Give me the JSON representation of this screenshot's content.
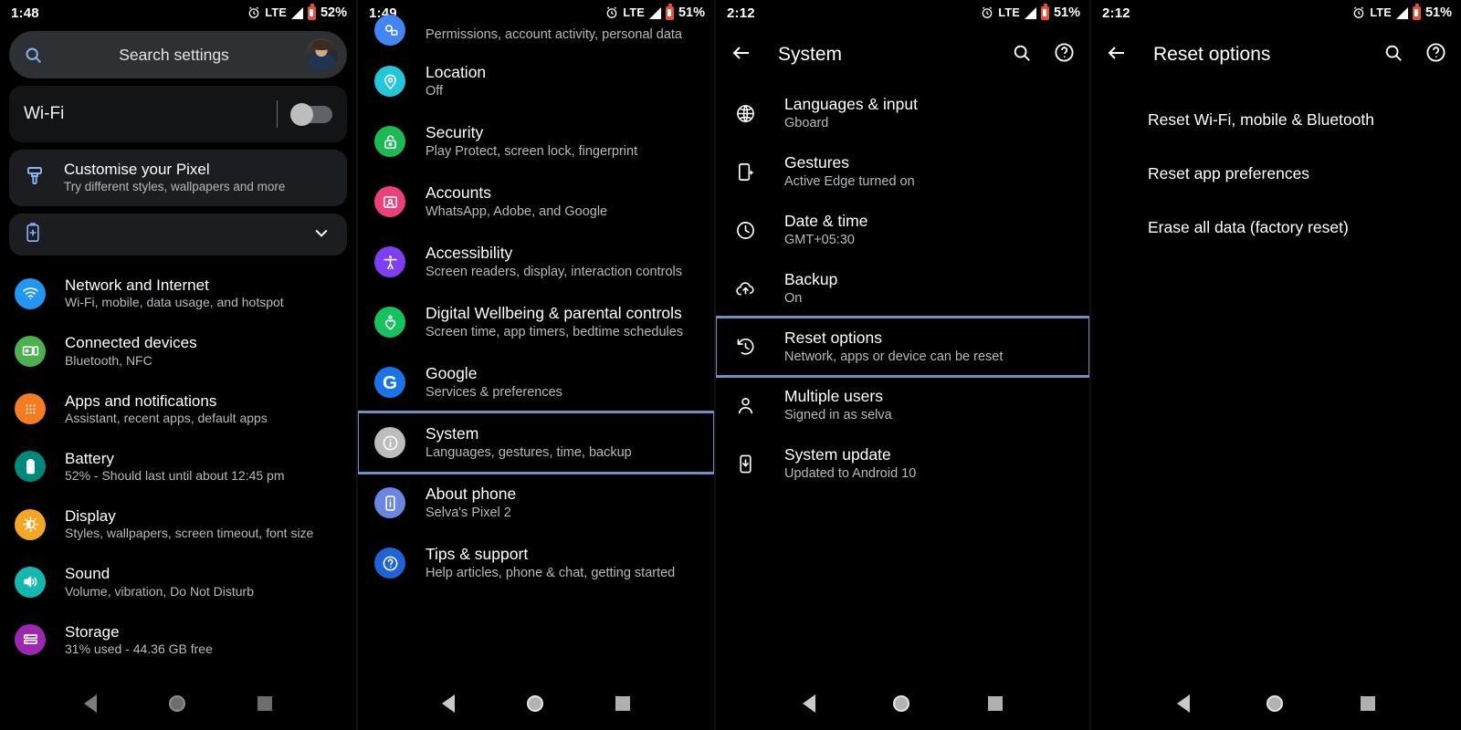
{
  "panels": [
    {
      "id": "settings-home",
      "status": {
        "time": "1:48",
        "network": "LTE",
        "battery_pct": "52%"
      },
      "search": {
        "placeholder": "Search settings"
      },
      "wifi_card": {
        "label": "Wi-Fi",
        "toggle_state": "off"
      },
      "customise_card": {
        "title": "Customise your Pixel",
        "subtitle": "Try different styles, wallpapers and more"
      },
      "battery_card": {
        "icon": "battery-plus-icon",
        "chevron": "chevron-down-icon"
      },
      "items": [
        {
          "title": "Network and Internet",
          "subtitle": "Wi-Fi, mobile, data usage, and hotspot",
          "icon": "wifi-icon",
          "color": "#2196f3"
        },
        {
          "title": "Connected devices",
          "subtitle": "Bluetooth, NFC",
          "icon": "devices-icon",
          "color": "#4caf50"
        },
        {
          "title": "Apps and notifications",
          "subtitle": "Assistant, recent apps, default apps",
          "icon": "apps-grid-icon",
          "color": "#f57c20"
        },
        {
          "title": "Battery",
          "subtitle": "52% - Should last until about 12:45 pm",
          "icon": "battery-icon",
          "color": "#00897b"
        },
        {
          "title": "Display",
          "subtitle": "Styles, wallpapers, screen timeout, font size",
          "icon": "brightness-icon",
          "color": "#f5a623"
        },
        {
          "title": "Sound",
          "subtitle": "Volume, vibration, Do Not Disturb",
          "icon": "volume-icon",
          "color": "#14b8b0"
        },
        {
          "title": "Storage",
          "subtitle": "31% used - 44.36 GB free",
          "icon": "storage-icon",
          "color": "#9c27b0"
        }
      ]
    },
    {
      "id": "settings-scrolled",
      "status": {
        "time": "1:49",
        "network": "LTE",
        "battery_pct": "51%"
      },
      "partial_top": {
        "subtitle": "Permissions, account activity, personal data",
        "icon": "privacy-icon",
        "color": "#4285f4"
      },
      "items": [
        {
          "title": "Location",
          "subtitle": "Off",
          "icon": "location-pin-icon",
          "color": "#26c6da"
        },
        {
          "title": "Security",
          "subtitle": "Play Protect, screen lock, fingerprint",
          "icon": "unlock-icon",
          "color": "#1db954"
        },
        {
          "title": "Accounts",
          "subtitle": "WhatsApp, Adobe, and Google",
          "icon": "account-card-icon",
          "color": "#ec407a"
        },
        {
          "title": "Accessibility",
          "subtitle": "Screen readers, display, interaction controls",
          "icon": "accessibility-icon",
          "color": "#7e3ff2"
        },
        {
          "title": "Digital Wellbeing & parental controls",
          "subtitle": "Screen time, app timers, bedtime schedules",
          "icon": "wellbeing-heart-icon",
          "color": "#16c25e"
        },
        {
          "title": "Google",
          "subtitle": "Services & preferences",
          "icon": "google-g-icon",
          "color": "#1a73e8"
        },
        {
          "title": "System",
          "subtitle": "Languages, gestures, time, backup",
          "icon": "info-icon",
          "color": "#bdbdbd",
          "highlighted": true
        },
        {
          "title": "About phone",
          "subtitle": "Selva's Pixel 2",
          "icon": "phone-info-icon",
          "color": "#6b86e0"
        },
        {
          "title": "Tips & support",
          "subtitle": "Help articles, phone & chat, getting started",
          "icon": "help-icon",
          "color": "#1f63d6"
        }
      ]
    },
    {
      "id": "system",
      "status": {
        "time": "2:12",
        "network": "LTE",
        "battery_pct": "51%"
      },
      "appbar": {
        "title": "System",
        "back": "back-arrow-icon",
        "search": "search-icon",
        "help": "help-icon"
      },
      "items": [
        {
          "title": "Languages & input",
          "subtitle": "Gboard",
          "icon": "globe-icon"
        },
        {
          "title": "Gestures",
          "subtitle": "Active Edge turned on",
          "icon": "gestures-icon"
        },
        {
          "title": "Date & time",
          "subtitle": "GMT+05:30",
          "icon": "clock-icon"
        },
        {
          "title": "Backup",
          "subtitle": "On",
          "icon": "cloud-upload-icon"
        },
        {
          "title": "Reset options",
          "subtitle": "Network, apps or device can be reset",
          "icon": "history-restore-icon",
          "highlighted": true
        },
        {
          "title": "Multiple users",
          "subtitle": "Signed in as selva",
          "icon": "person-icon"
        },
        {
          "title": "System update",
          "subtitle": "Updated to Android 10",
          "icon": "phone-download-icon"
        }
      ]
    },
    {
      "id": "reset-options",
      "status": {
        "time": "2:12",
        "network": "LTE",
        "battery_pct": "51%"
      },
      "appbar": {
        "title": "Reset options",
        "back": "back-arrow-icon",
        "search": "search-icon",
        "help": "help-icon"
      },
      "items": [
        {
          "title": "Reset Wi-Fi, mobile & Bluetooth"
        },
        {
          "title": "Reset app preferences"
        },
        {
          "title": "Erase all data (factory reset)"
        }
      ]
    }
  ],
  "navbar": {
    "back": "nav-back-icon",
    "home": "nav-home-icon",
    "recents": "nav-recents-icon"
  },
  "colors": {
    "highlight": "#6f90c6",
    "background": "#000000",
    "card": "#1c1d20",
    "search_card": "#2e3134"
  }
}
